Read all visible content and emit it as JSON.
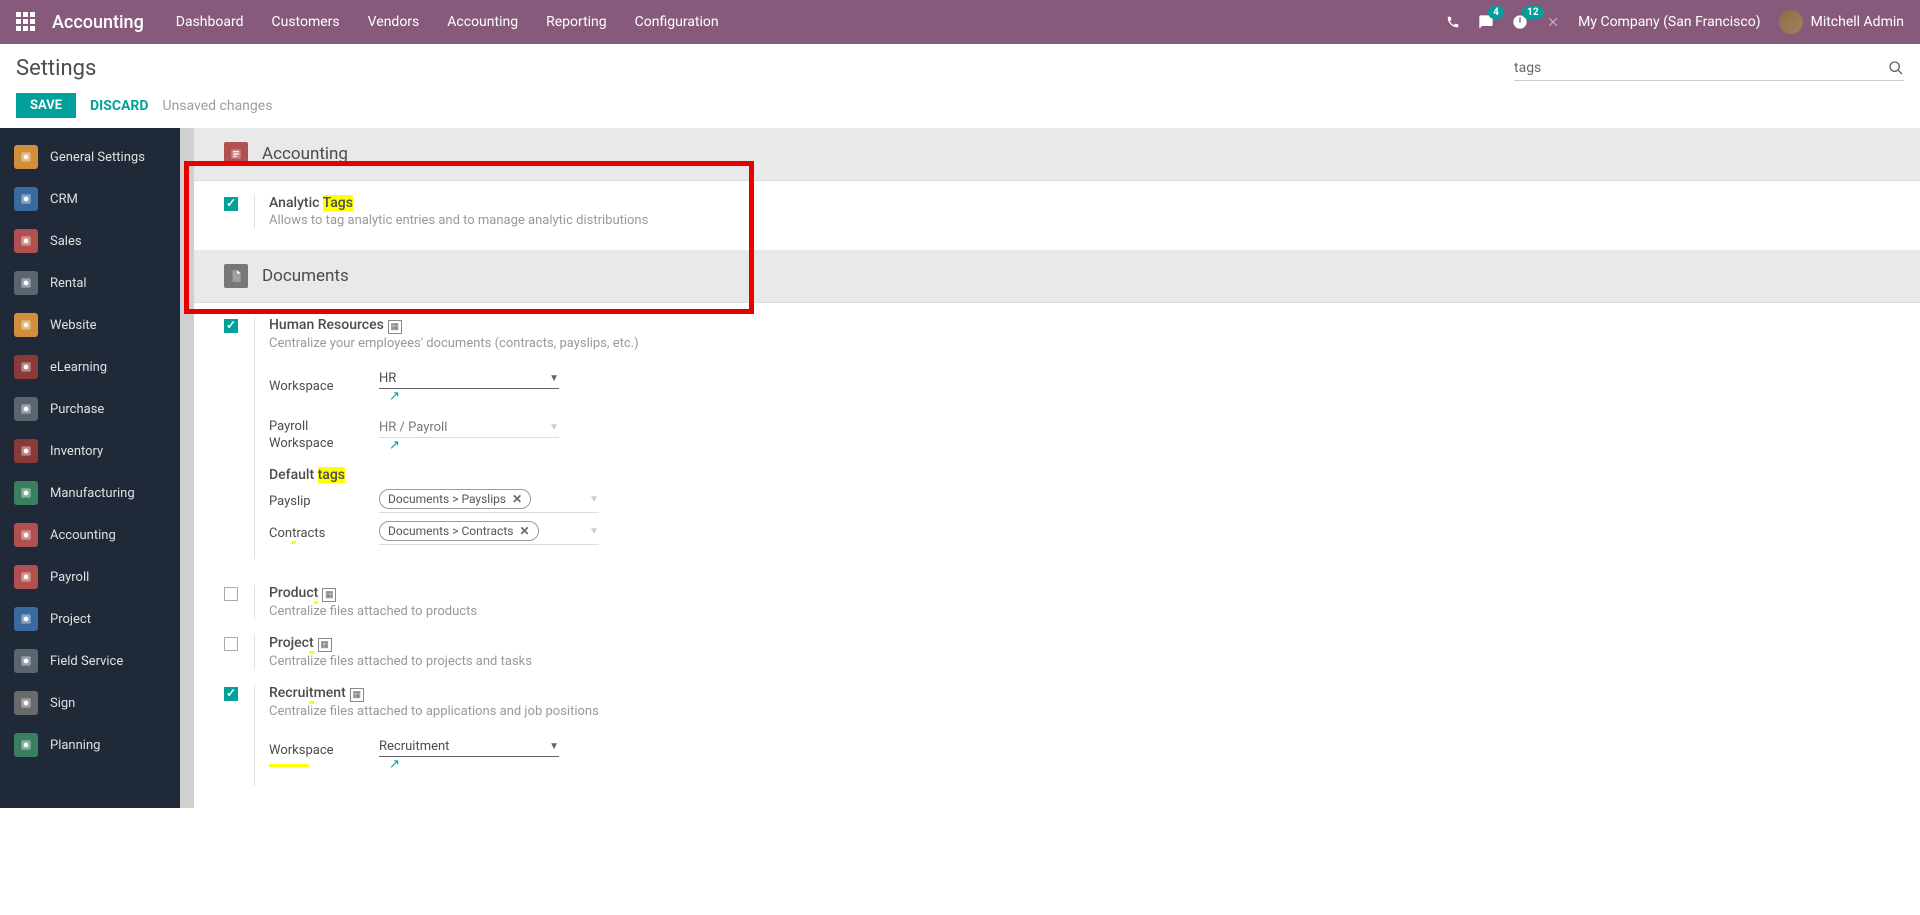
{
  "topnav": {
    "brand": "Accounting",
    "menu": [
      "Dashboard",
      "Customers",
      "Vendors",
      "Accounting",
      "Reporting",
      "Configuration"
    ],
    "chat_badge": "4",
    "activity_badge": "12",
    "company": "My Company (San Francisco)",
    "user": "Mitchell Admin"
  },
  "header": {
    "title": "Settings",
    "search_value": "tags",
    "save": "SAVE",
    "discard": "DISCARD",
    "unsaved": "Unsaved changes"
  },
  "sidebar": [
    {
      "label": "General Settings",
      "bg": "#d08f3a"
    },
    {
      "label": "CRM",
      "bg": "#3a6aa0"
    },
    {
      "label": "Sales",
      "bg": "#b05050"
    },
    {
      "label": "Rental",
      "bg": "#5a6570"
    },
    {
      "label": "Website",
      "bg": "#d08f3a"
    },
    {
      "label": "eLearning",
      "bg": "#8b3a3a"
    },
    {
      "label": "Purchase",
      "bg": "#5a6570"
    },
    {
      "label": "Inventory",
      "bg": "#8b3a3a"
    },
    {
      "label": "Manufacturing",
      "bg": "#3a8060"
    },
    {
      "label": "Accounting",
      "bg": "#b05050"
    },
    {
      "label": "Payroll",
      "bg": "#b05050"
    },
    {
      "label": "Project",
      "bg": "#3a6aa0"
    },
    {
      "label": "Field Service",
      "bg": "#5a6570"
    },
    {
      "label": "Sign",
      "bg": "#6a6a6a"
    },
    {
      "label": "Planning",
      "bg": "#3a8060"
    }
  ],
  "sections": {
    "accounting": {
      "title": "Accounting",
      "analytic": {
        "pre": "Analytic ",
        "hl": "Tags",
        "desc": "Allows to tag analytic entries and to manage analytic distributions",
        "checked": true
      }
    },
    "documents": {
      "title": "Documents",
      "hr": {
        "title": "Human Resources",
        "checked": true,
        "desc": "Centralize your employees' documents (contracts, payslips, etc.)",
        "workspace_label": "Workspace",
        "workspace_value": "HR",
        "payroll_label": "Payroll Workspace",
        "payroll_value": "HR / Payroll",
        "defaults_pre": "Default ",
        "defaults_hl": "tags",
        "payslip_label": "Payslip",
        "payslip_tag": "Documents > Payslips",
        "contracts_label_pre": "Con",
        "contracts_label_t": "t",
        "contracts_label_post": "racts",
        "contracts_tag": "Documents > Contracts"
      },
      "product": {
        "pre": "Produc",
        "t": "t",
        "desc": "Centralize files attached to products",
        "checked": false
      },
      "project": {
        "pre": "Projec",
        "t": "t",
        "desc": "Centralize files attached to projects and tasks",
        "checked": false
      },
      "recruitment": {
        "pre": "Recrui",
        "t": "t",
        "post": "ment",
        "desc": "Centralize files attached to applications and job positions",
        "checked": true,
        "workspace_label": "Workspace",
        "workspace_value": "Recruitment"
      }
    }
  }
}
